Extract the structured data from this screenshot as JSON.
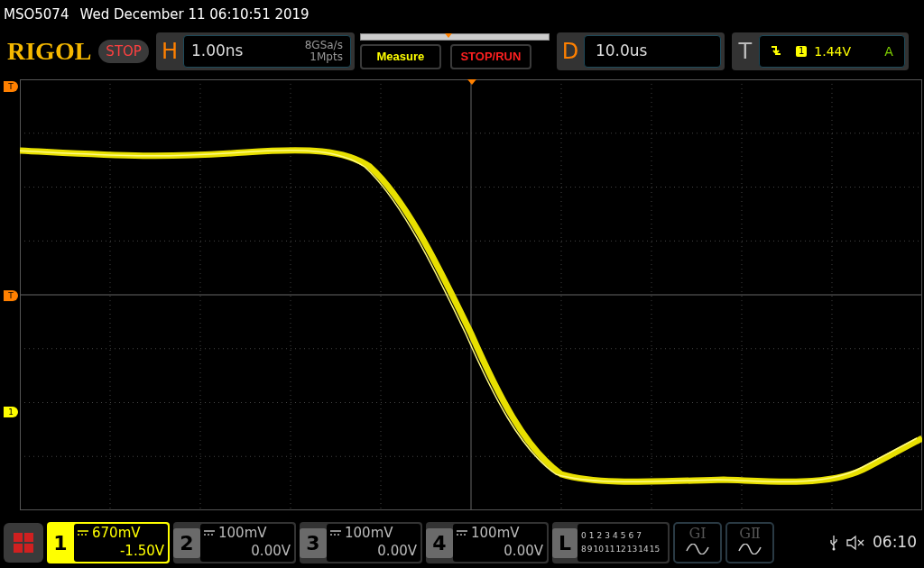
{
  "title_bar": {
    "model": "MSO5074",
    "datetime": "Wed December 11 06:10:51 2019"
  },
  "logo": "RIGOL",
  "run_state": "STOP",
  "horizontal": {
    "label": "H",
    "scale": "1.00ns",
    "sample_rate": "8GSa/s",
    "memory_depth": "1Mpts"
  },
  "buttons": [
    {
      "label": "Measure",
      "kind": "menu"
    },
    {
      "label": "STOP/RUN",
      "kind": "action"
    }
  ],
  "delay": {
    "label": "D",
    "value": "10.0us"
  },
  "trigger": {
    "label": "T",
    "source": "1",
    "level": "1.44V",
    "mode": "A"
  },
  "markers": [
    {
      "label": "T",
      "color": "#ff8000"
    },
    {
      "label": "T",
      "color": "#ff8000"
    },
    {
      "label": "1",
      "color": "#ffff00"
    }
  ],
  "channels": [
    {
      "number": "1",
      "scale": "670mV",
      "offset": "-1.50V",
      "selected": true
    },
    {
      "number": "2",
      "scale": "100mV",
      "offset": "0.00V",
      "selected": false
    },
    {
      "number": "3",
      "scale": "100mV",
      "offset": "0.00V",
      "selected": false
    },
    {
      "number": "4",
      "scale": "100mV",
      "offset": "0.00V",
      "selected": false
    }
  ],
  "logic": {
    "label": "L",
    "row_1": [
      "0",
      "1",
      "2",
      "3",
      "4",
      "5",
      "6",
      "7"
    ],
    "row_2": [
      "8",
      "9",
      "10",
      "11",
      "12",
      "13",
      "14",
      "15"
    ]
  },
  "math": [
    {
      "label": "GI"
    },
    {
      "label": "GⅡ"
    }
  ],
  "status": {
    "time": "06:10"
  }
}
